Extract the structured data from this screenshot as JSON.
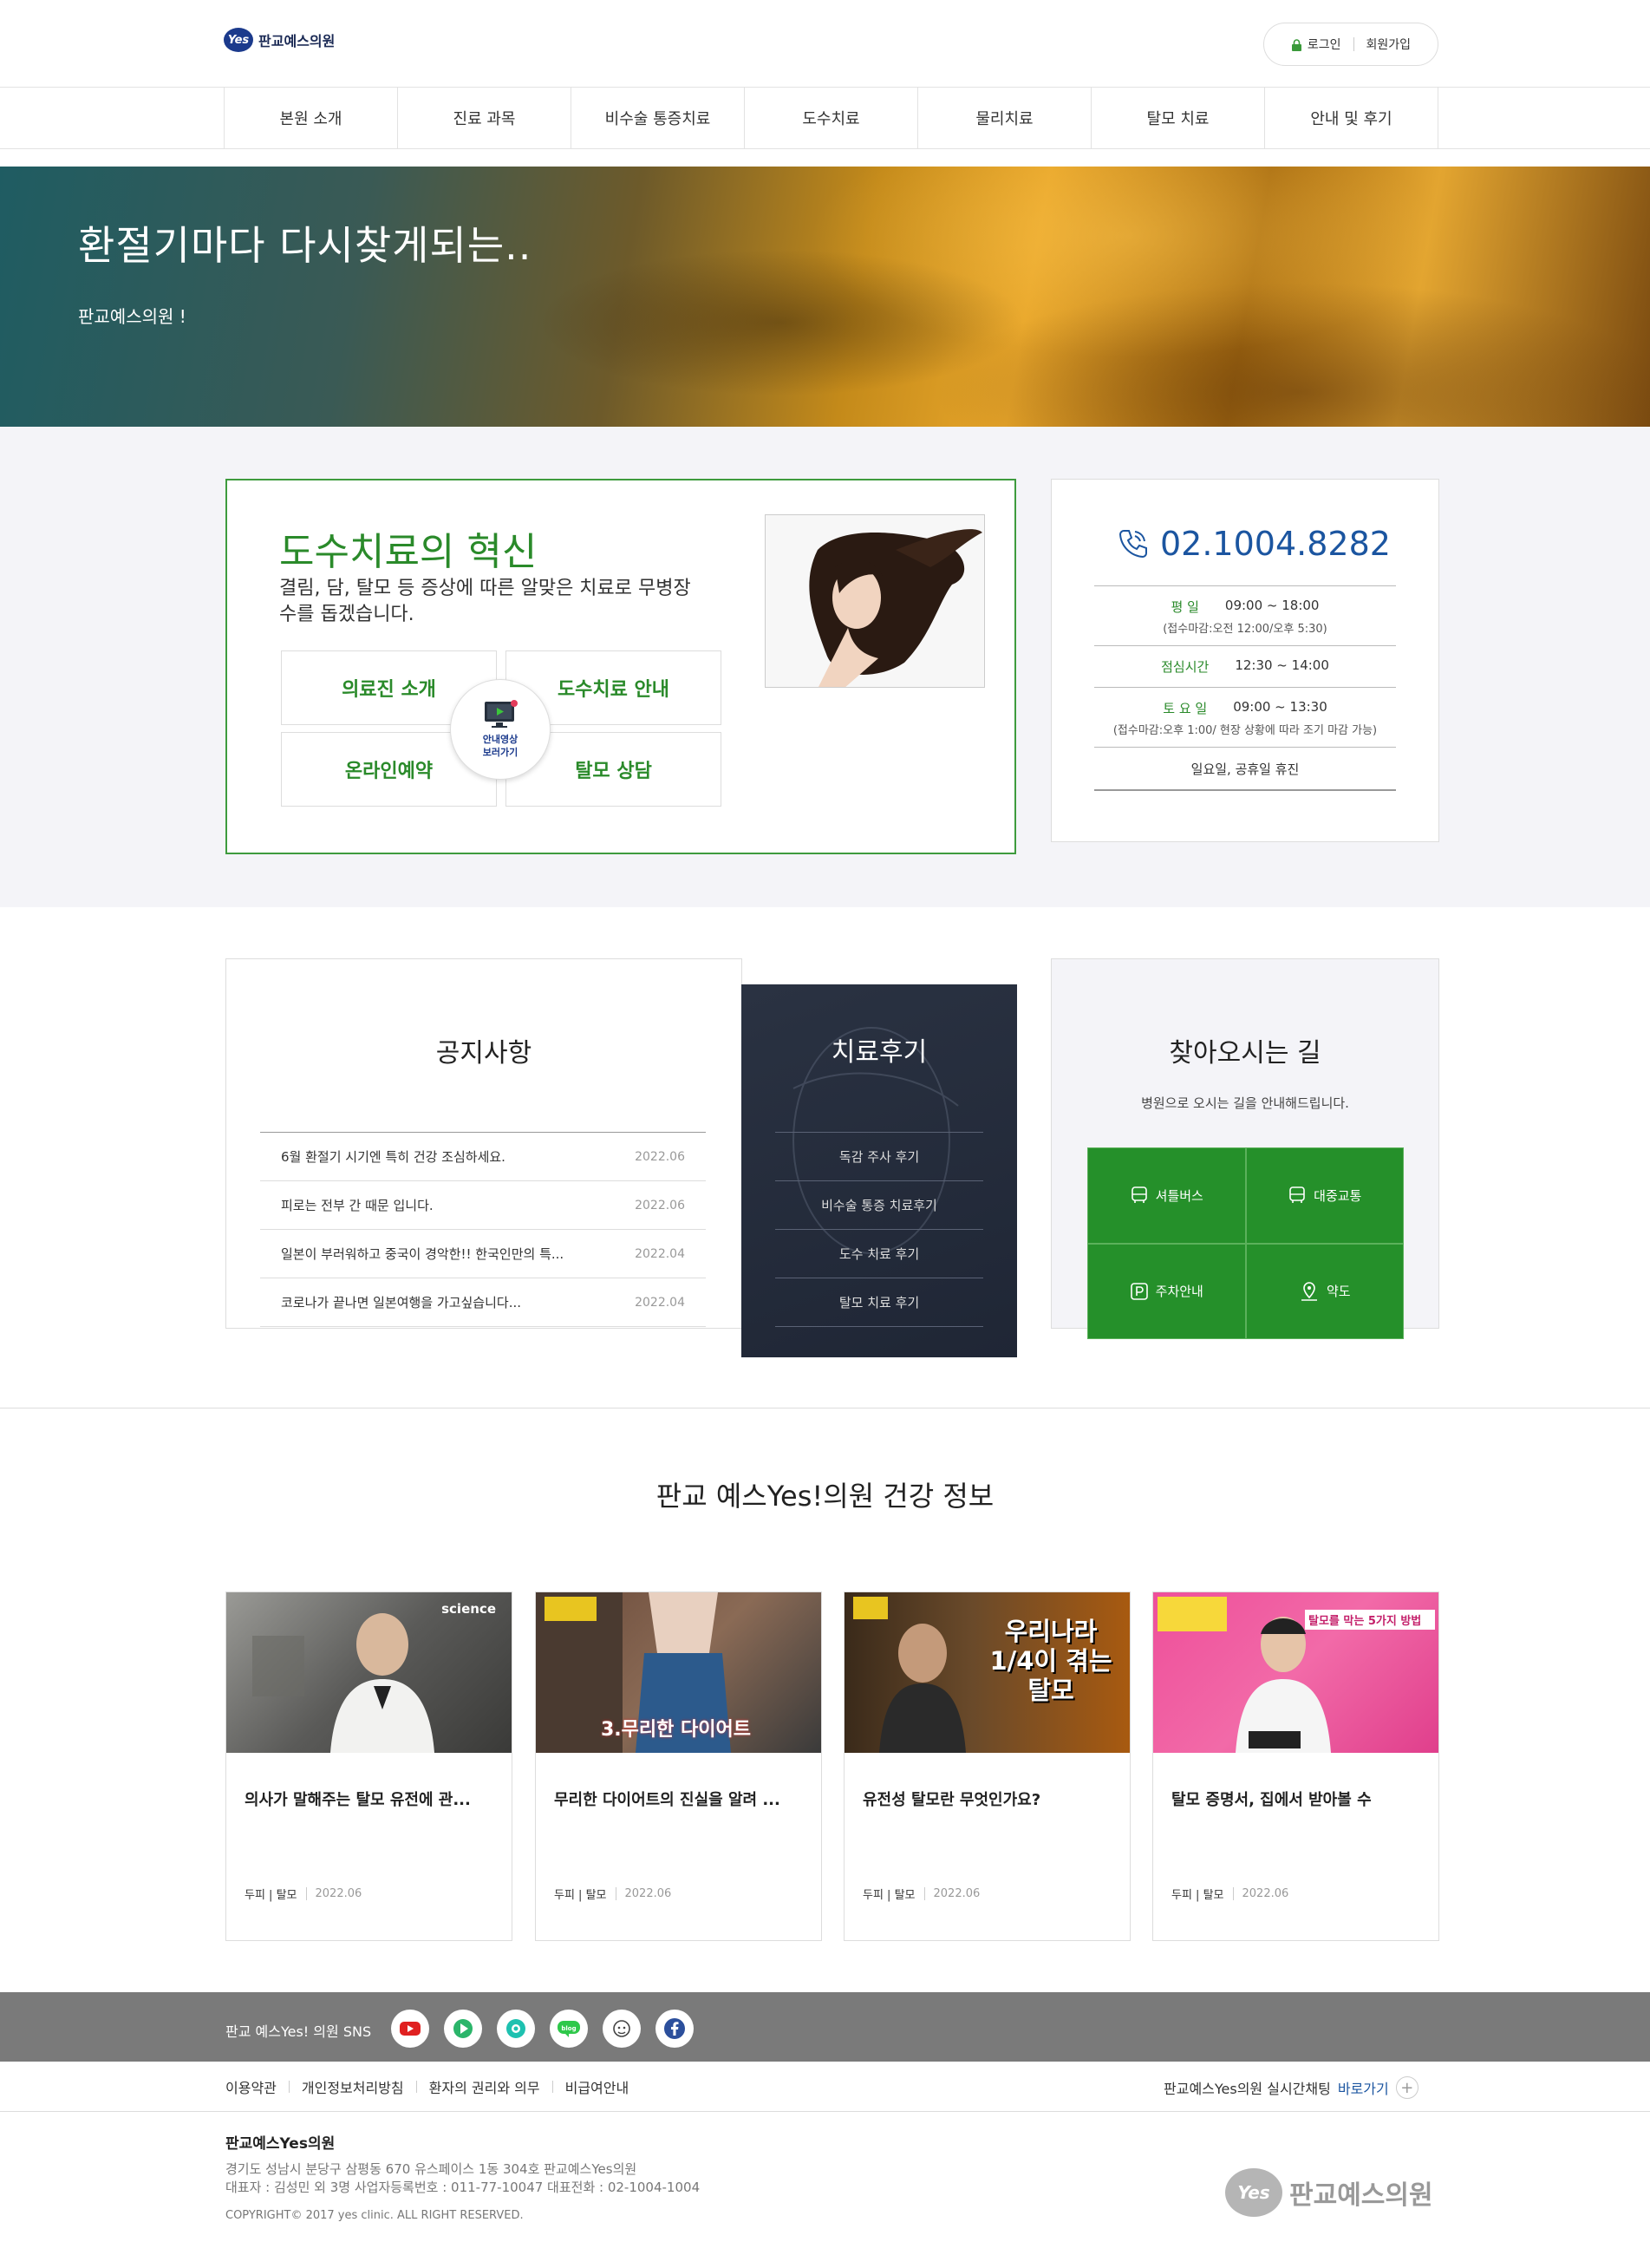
{
  "header": {
    "logo_mark": "Yes",
    "logo_text": "판교예스의원",
    "login": "로그인",
    "signup": "회원가입"
  },
  "nav": [
    "본원 소개",
    "진료 과목",
    "비수술 통증치료",
    "도수치료",
    "물리치료",
    "탈모 치료",
    "안내 및 후기"
  ],
  "hero": {
    "title": "환절기마다 다시찾게되는..",
    "subtitle": "판교예스의원 !"
  },
  "promo": {
    "title": "도수치료의 혁신",
    "desc": "결림, 담, 탈모 등 증상에 따른 알맞은 치료로 무병장수를 돕겠습니다.",
    "buttons": [
      "의료진 소개",
      "도수치료 안내",
      "온라인예약",
      "탈모 상담"
    ],
    "video_label_1": "안내영상",
    "video_label_2": "보러가기"
  },
  "contact": {
    "phone": "02.1004.8282",
    "weekday_label": "평 일",
    "weekday_hours": "09:00 ~ 18:00",
    "weekday_note": "(접수마감:오전 12:00/오후 5:30)",
    "lunch_label": "점심시간",
    "lunch_hours": "12:30 ~ 14:00",
    "sat_label": "토 요 일",
    "sat_hours": "09:00 ~ 13:30",
    "sat_note": "(접수마감:오후 1:00/ 현장 상황에 따라 조기 마감 가능)",
    "closed": "일요일, 공휴일 휴진"
  },
  "notice": {
    "title": "공지사항",
    "items": [
      {
        "text": "6월 환절기 시기엔 특히 건강 조심하세요.",
        "date": "2022.06"
      },
      {
        "text": "피로는 전부 간 때문 입니다.",
        "date": "2022.06"
      },
      {
        "text": "일본이 부러워하고 중국이 경악한!! 한국인만의 특...",
        "date": "2022.04"
      },
      {
        "text": "코로나가 끝나면 일본여행을 가고싶습니다...",
        "date": "2022.04"
      }
    ]
  },
  "review": {
    "title": "치료후기",
    "items": [
      "독감 주사 후기",
      "비수술 통증 치료후기",
      "도수 치료 후기",
      "탈모 치료 후기"
    ]
  },
  "directions": {
    "title": "찾아오시는 길",
    "desc": "병원으로 오시는 길을 안내해드립니다.",
    "items": [
      "셔틀버스",
      "대중교통",
      "주차안내",
      "약도"
    ]
  },
  "health": {
    "title": "판교 예스Yes!의원 건강 정보",
    "cards": [
      {
        "title": "의사가 말해주는 탈모 유전에 관...",
        "category": "두피 | 탈모",
        "date": "2022.06",
        "thumb_text": "science"
      },
      {
        "title": "무리한 다이어트의 진실을 알려 ...",
        "category": "두피 | 탈모",
        "date": "2022.06",
        "thumb_text": "3.무리한 다이어트"
      },
      {
        "title": "유전성 탈모란 무엇인가요?",
        "category": "두피 | 탈모",
        "date": "2022.06",
        "thumb_text": "우리나라 1/4이 겪는탈모"
      },
      {
        "title": "탈모 증명서, 집에서 받아볼 수",
        "category": "두피 | 탈모",
        "date": "2022.06",
        "thumb_text": "탈모를 막는 5가지 방법"
      }
    ]
  },
  "footer": {
    "sns_label": "판교 예스Yes! 의원 SNS",
    "links": [
      "이용약관",
      "개인정보처리방침",
      "환자의 권리와 의무",
      "비급여안내"
    ],
    "chat_label": "판교예스Yes의원 실시간채팅",
    "chat_link": "바로가기",
    "name": "판교예스Yes의원",
    "address": "경기도 성남시 분당구 삼평동 670 유스페이스 1동 304호 판교예스Yes의원",
    "info": "대표자 : 김성민 외 3명   사업자등록번호 : 011-77-10047   대표전화 : 02-1004-1004",
    "copyright": "COPYRIGHT© 2017 yes clinic. ALL RIGHT RESERVED.",
    "logo_text": "판교예스의원"
  }
}
